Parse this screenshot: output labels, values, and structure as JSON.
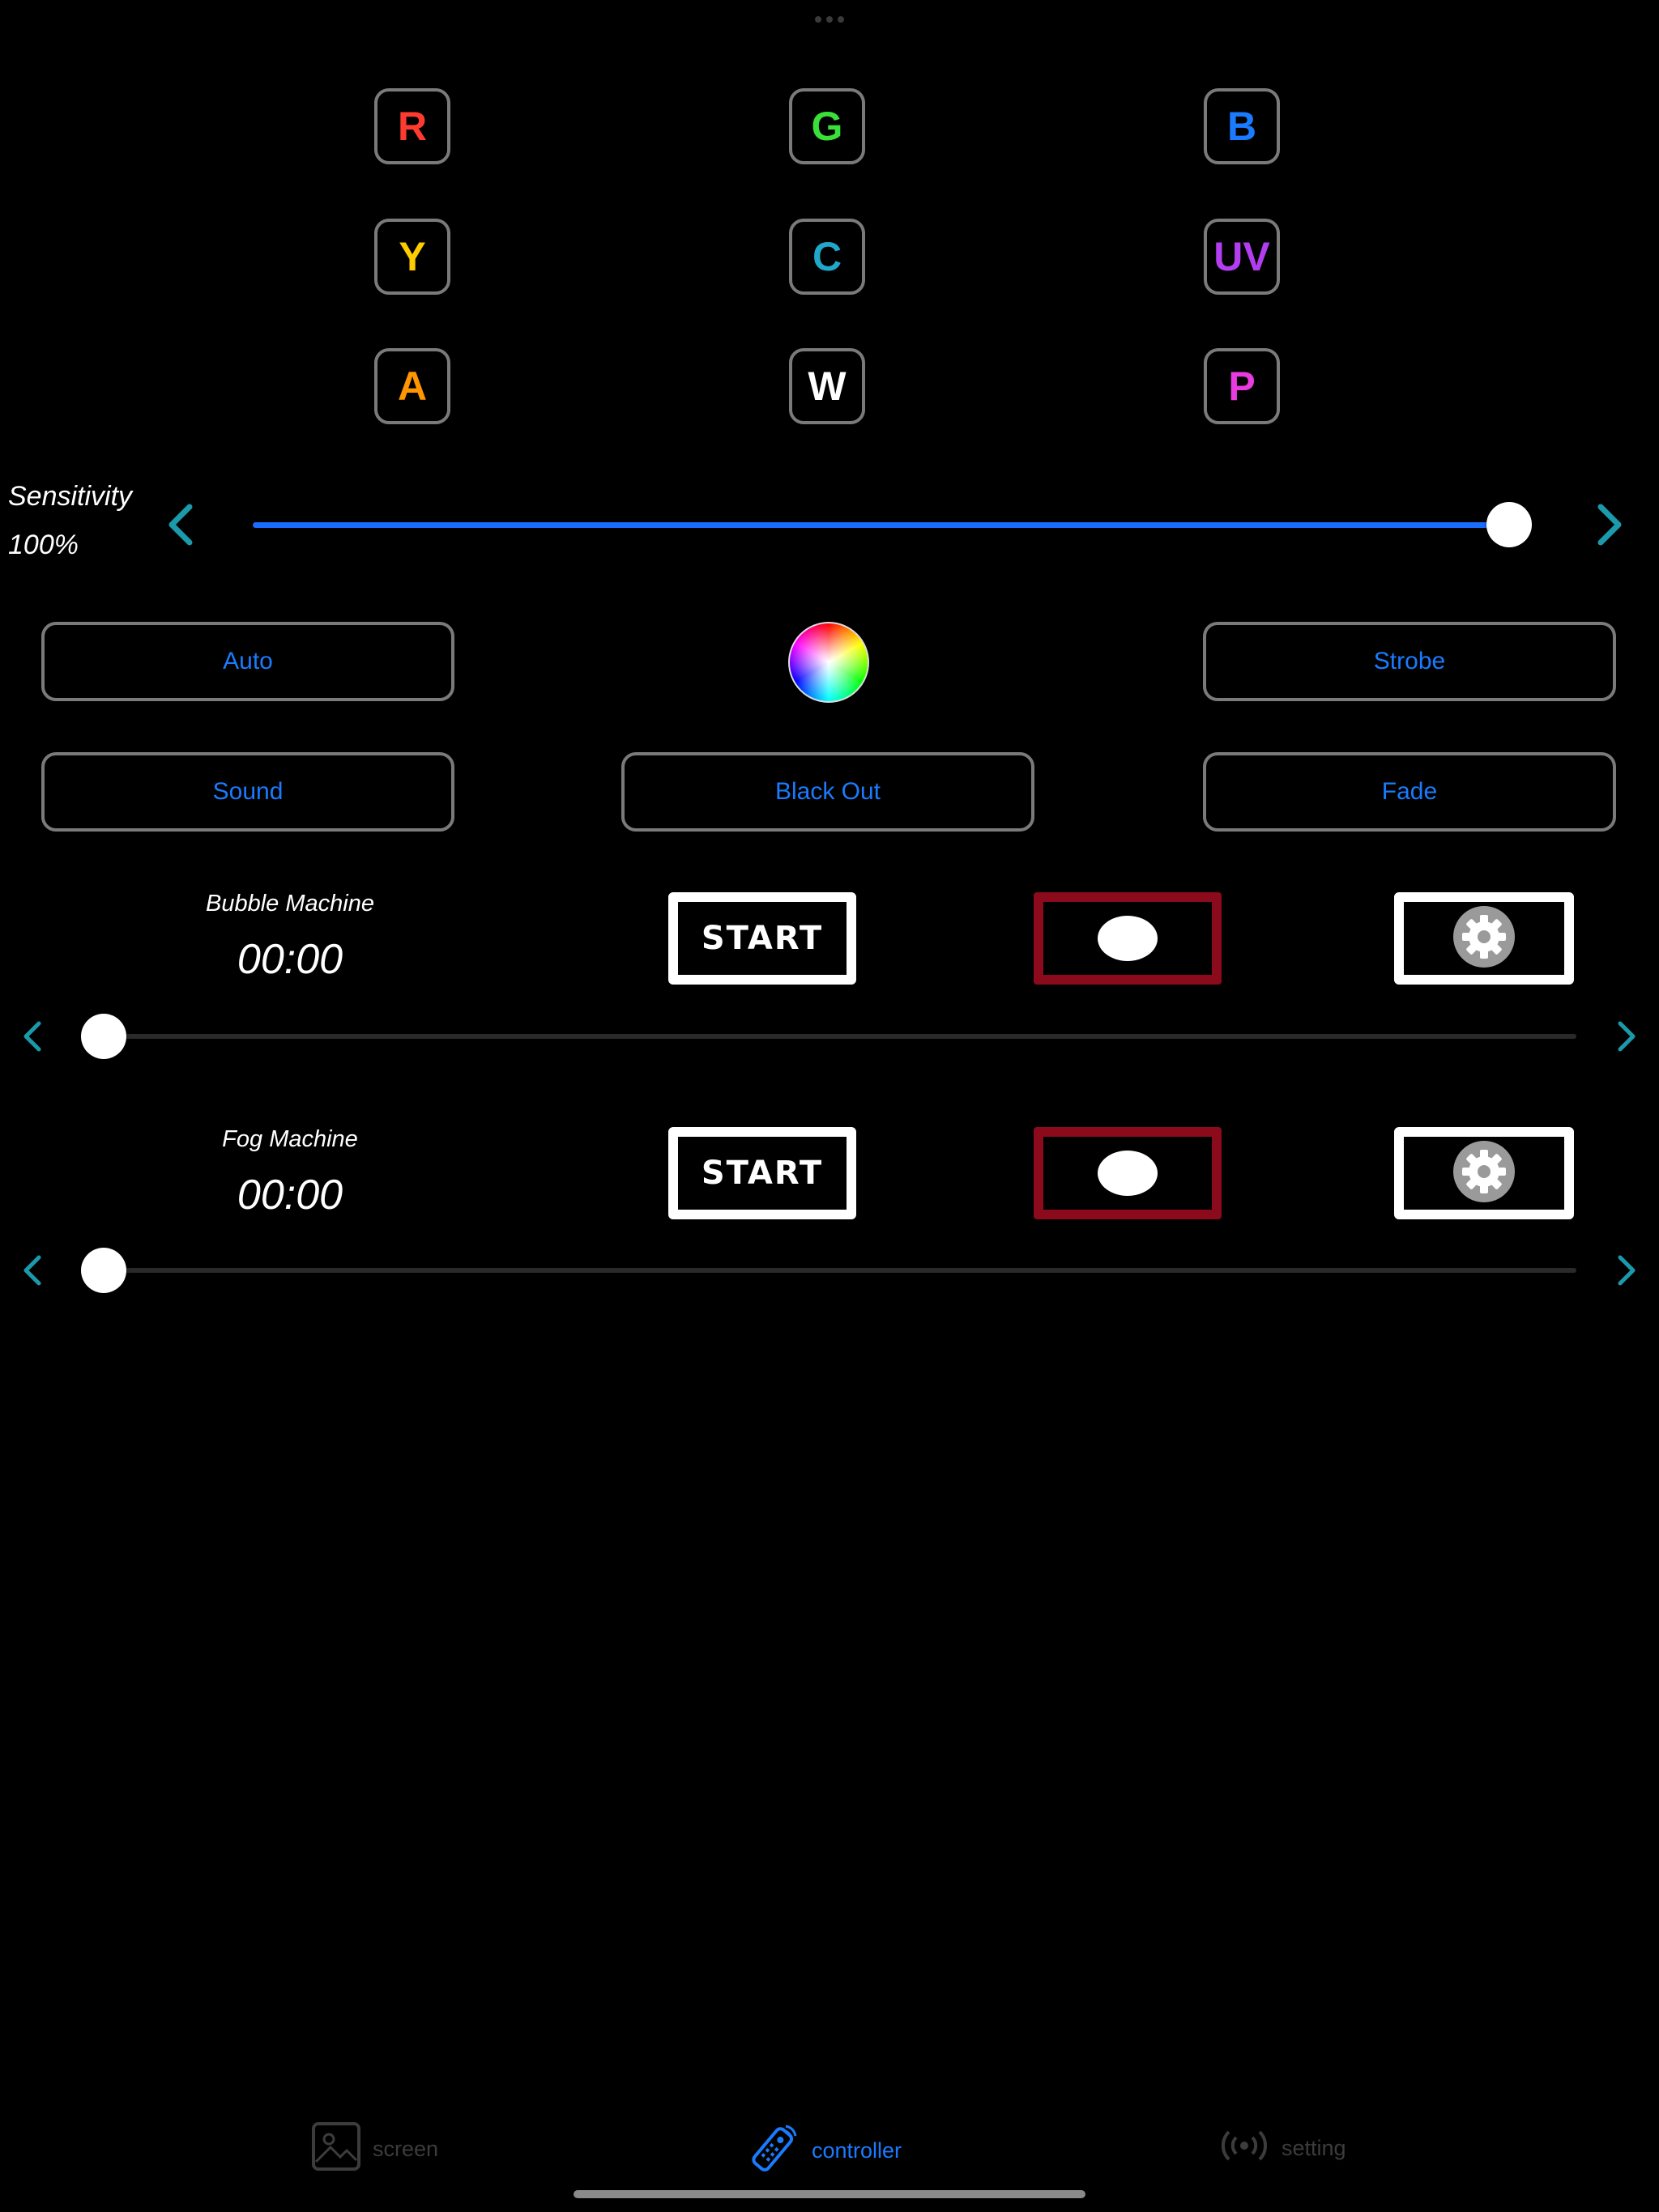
{
  "color_buttons": {
    "r": {
      "label": "R",
      "color": "#ff3b30"
    },
    "g": {
      "label": "G",
      "color": "#3ae03a"
    },
    "b": {
      "label": "B",
      "color": "#1a7bff"
    },
    "y": {
      "label": "Y",
      "color": "#ffcc00"
    },
    "c": {
      "label": "C",
      "color": "#21a7c9"
    },
    "uv": {
      "label": "UV",
      "color": "#b23ef0"
    },
    "a": {
      "label": "A",
      "color": "#ff9500"
    },
    "w": {
      "label": "W",
      "color": "#ffffff"
    },
    "p": {
      "label": "P",
      "color": "#e83ce0"
    }
  },
  "sensitivity": {
    "label": "Sensitivity",
    "value": "100%",
    "level": 1.0
  },
  "modes": {
    "auto": "Auto",
    "strobe": "Strobe",
    "sound": "Sound",
    "blackout": "Black Out",
    "fade": "Fade"
  },
  "machines": {
    "bubble": {
      "name": "Bubble Machine",
      "time": "00:00",
      "start_label": "START",
      "level": 0.0
    },
    "fog": {
      "name": "Fog Machine",
      "time": "00:00",
      "start_label": "START",
      "level": 0.0
    }
  },
  "tabbar": {
    "screen": "screen",
    "controller": "controller",
    "setting": "setting",
    "active": "controller"
  },
  "colors": {
    "accent": "#1a7bff",
    "chevron": "#1a9aaa",
    "toggle_border": "#8b0a1c"
  }
}
